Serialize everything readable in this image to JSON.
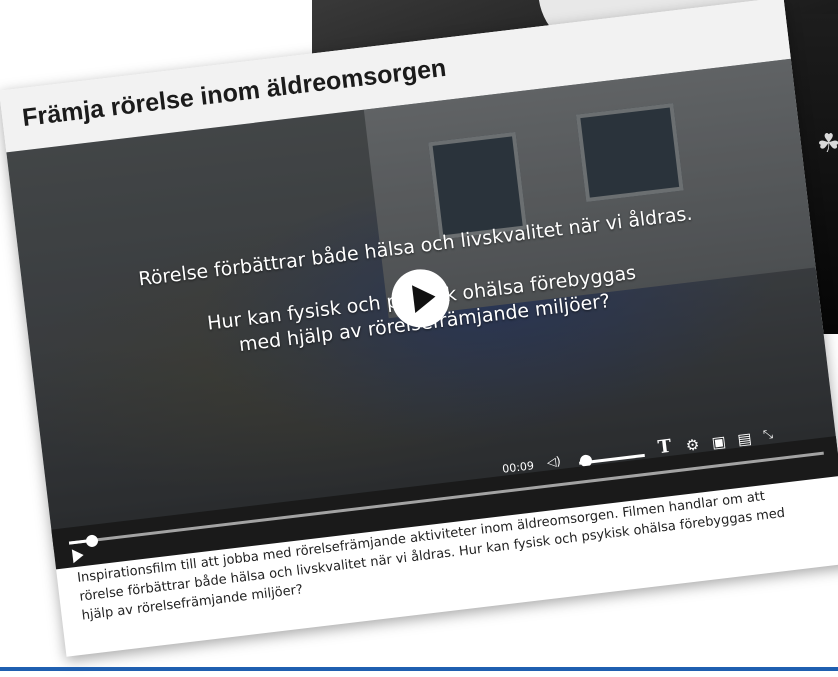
{
  "card": {
    "title": "Främja rörelse inom äldreomsorgen",
    "description": "Inspirationsfilm till att jobba med rörelsefrämjande aktiviteter inom äldreomsorgen. Filmen handlar om att rörelse förbättrar både hälsa och livskvalitet när vi åldras. Hur kan fysisk och psykisk ohälsa förebyggas med hjälp av rörelsefrämjande miljöer?"
  },
  "video": {
    "caption_line1": "Rörelse förbättrar både hälsa och livskvalitet när vi åldras.",
    "caption_line2a": "Hur kan fysisk och psykisk ohälsa förebyggas",
    "caption_line2b": "med hjälp av rörelsefrämjande miljöer?",
    "time": "00:09",
    "progress_fraction": 0.03,
    "volume_fraction": 0.1
  },
  "icons": {
    "play": "play-icon",
    "volume": "volume-icon",
    "text": "text-size-icon",
    "settings": "gear-icon",
    "pip": "picture-in-picture-icon",
    "captions": "captions-icon",
    "fullscreen": "fullscreen-icon"
  },
  "colors": {
    "accent_rule": "#1f5fb0",
    "title_bar": "#f2f2f2"
  }
}
